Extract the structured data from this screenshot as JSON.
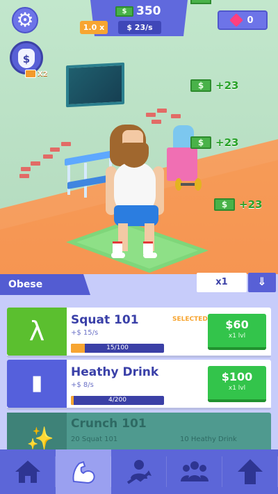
{
  "hud": {
    "money": "350",
    "multiplier": "1.0 x",
    "rate": "$ 23/s",
    "gems": "0",
    "ad_bonus": "X2"
  },
  "floating_cash": [
    {
      "value": "+23"
    },
    {
      "value": "+23"
    },
    {
      "value": "+23"
    }
  ],
  "category": {
    "label": "Obese",
    "multiplier": "x1"
  },
  "items": [
    {
      "name": "Squat 101",
      "rate": "+$ 15/s",
      "progress_text": "15/100",
      "progress": 0.15,
      "status": "SELECTED",
      "price": "$60",
      "level": "x1 lvl",
      "icon": "squat-icon",
      "color": "#5bbf2f"
    },
    {
      "name": "Heathy Drink",
      "rate": "+$ 8/s",
      "progress_text": "4/200",
      "progress": 0.02,
      "status": "",
      "price": "$100",
      "level": "x1 lvl",
      "icon": "bottle-icon",
      "color": "#5560dc"
    },
    {
      "name": "Crunch 101",
      "requirement_1": "20 Squat 101",
      "requirement_2": "10 Heathy Drink",
      "icon": "crunch-icon",
      "color": "#4f9a8f"
    }
  ],
  "nav": [
    {
      "name": "home-icon"
    },
    {
      "name": "muscle-icon"
    },
    {
      "name": "trainer-icon"
    },
    {
      "name": "group-icon"
    },
    {
      "name": "upgrade-arrow-icon"
    }
  ]
}
